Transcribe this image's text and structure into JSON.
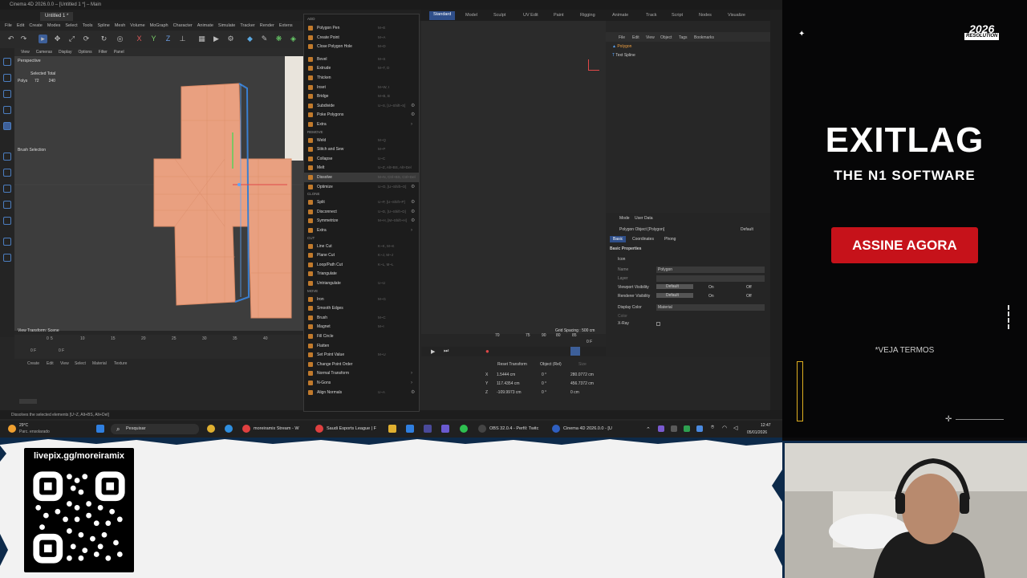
{
  "window": {
    "title": "Cinema 4D 2026.0.0 – [Untitled 1 *] – Main",
    "doc_tab": "Untitled 1 *"
  },
  "menubar": [
    "File",
    "Edit",
    "Create",
    "Modes",
    "Select",
    "Tools",
    "Spline",
    "Mesh",
    "Volume",
    "MoGraph",
    "Character",
    "Animate",
    "Simulate",
    "Tracker",
    "Render",
    "Extens"
  ],
  "layout_tabs": [
    "Standard",
    "Model",
    "Sculpt",
    "UV Edit",
    "Paint",
    "Rigging",
    "Animate",
    "Track",
    "Script",
    "Nodes",
    "Visualize"
  ],
  "viewport": {
    "menu": [
      "View",
      "Cameras",
      "Display",
      "Options",
      "Filter",
      "Panel"
    ],
    "title": "Perspective",
    "stats_header": "Selected Total",
    "stats_label": "Polys",
    "stats_selected": "72",
    "stats_total": "240",
    "brush_label": "Brush Selection",
    "transform_label": "View Transform: Scene",
    "grid_spacing": "Grid Spacing : 500 cm"
  },
  "timeline": {
    "ticks": [
      "0",
      "5",
      "10",
      "15",
      "20",
      "25",
      "30",
      "35",
      "40"
    ],
    "frame_start": "0 F",
    "frame_current": "0 F",
    "right_ticks": [
      "70",
      "75",
      "80",
      "85",
      "90"
    ],
    "right_frame": "0 F"
  },
  "material": {
    "menu": [
      "Create",
      "Edit",
      "View",
      "Select",
      "Material",
      "Texture"
    ]
  },
  "menu": {
    "add_section": "ADD",
    "items": [
      {
        "label": "Polygon Pen",
        "shortcut": "M~E",
        "section": "",
        "gear": false,
        "arrow": false
      },
      {
        "label": "Create Point",
        "shortcut": "M~A",
        "section": "",
        "gear": false,
        "arrow": false
      },
      {
        "label": "Close Polygon Hole",
        "shortcut": "M~D",
        "section": "",
        "gear": false,
        "arrow": false
      },
      {
        "label": "Bevel",
        "shortcut": "M~S",
        "section": "",
        "gear": false,
        "arrow": false
      },
      {
        "label": "Extrude",
        "shortcut": "M~T, D",
        "section": "",
        "gear": false,
        "arrow": false
      },
      {
        "label": "Thicken",
        "shortcut": "",
        "section": "",
        "gear": false,
        "arrow": false
      },
      {
        "label": "Inset",
        "shortcut": "M~W, I",
        "section": "",
        "gear": false,
        "arrow": false
      },
      {
        "label": "Bridge",
        "shortcut": "M~B, B",
        "section": "",
        "gear": false,
        "arrow": false
      },
      {
        "label": "Subdivide",
        "shortcut": "U~S, [U~Shift~S]",
        "section": "",
        "gear": true,
        "arrow": false
      },
      {
        "label": "Poke Polygons",
        "shortcut": "",
        "section": "",
        "gear": true,
        "arrow": false
      },
      {
        "label": "Extra",
        "shortcut": "",
        "section": "",
        "gear": false,
        "arrow": true
      },
      {
        "label": "Weld",
        "shortcut": "M~Q",
        "section": "REMOVE",
        "gear": false,
        "arrow": false
      },
      {
        "label": "Stitch and Sew",
        "shortcut": "M~P",
        "section": "",
        "gear": false,
        "arrow": false
      },
      {
        "label": "Collapse",
        "shortcut": "U~C",
        "section": "",
        "gear": false,
        "arrow": false
      },
      {
        "label": "Melt",
        "shortcut": "U~Z, Alt+BS, Alt+Del",
        "section": "",
        "gear": false,
        "arrow": false
      },
      {
        "label": "Dissolve",
        "shortcut": "M~N, Ctrl+BS, Ctrl+Del",
        "section": "",
        "gear": false,
        "arrow": false
      },
      {
        "label": "Optimize",
        "shortcut": "U~O, [U~Shift~O]",
        "section": "",
        "gear": true,
        "arrow": false
      },
      {
        "label": "Split",
        "shortcut": "U~P, [U~Shift~P]",
        "section": "CLONE",
        "gear": true,
        "arrow": false
      },
      {
        "label": "Disconnect",
        "shortcut": "U~D, [U~Shift~D]",
        "section": "",
        "gear": true,
        "arrow": false
      },
      {
        "label": "Symmetrize",
        "shortcut": "M~H, [M~Shift~H]",
        "section": "",
        "gear": true,
        "arrow": false
      },
      {
        "label": "Extra",
        "shortcut": "",
        "section": "",
        "gear": false,
        "arrow": true
      },
      {
        "label": "Line Cut",
        "shortcut": "K~K, M~K",
        "section": "CUT",
        "gear": false,
        "arrow": false
      },
      {
        "label": "Plane Cut",
        "shortcut": "K~J, M~J",
        "section": "",
        "gear": false,
        "arrow": false
      },
      {
        "label": "Loop/Path Cut",
        "shortcut": "K~L, M~L",
        "section": "",
        "gear": false,
        "arrow": false
      },
      {
        "label": "Triangulate",
        "shortcut": "",
        "section": "",
        "gear": false,
        "arrow": false
      },
      {
        "label": "Untriangulate",
        "shortcut": "U~U",
        "section": "",
        "gear": false,
        "arrow": false
      },
      {
        "label": "Iron",
        "shortcut": "M~G",
        "section": "MOVE",
        "gear": false,
        "arrow": false
      },
      {
        "label": "Smooth Edges",
        "shortcut": "",
        "section": "",
        "gear": false,
        "arrow": false
      },
      {
        "label": "Brush",
        "shortcut": "M~C",
        "section": "",
        "gear": false,
        "arrow": false
      },
      {
        "label": "Magnet",
        "shortcut": "M~I",
        "section": "",
        "gear": false,
        "arrow": false
      },
      {
        "label": "Fill Circle",
        "shortcut": "",
        "section": "",
        "gear": false,
        "arrow": false
      },
      {
        "label": "Flatten",
        "shortcut": "",
        "section": "",
        "gear": false,
        "arrow": false
      },
      {
        "label": "Set Point Value",
        "shortcut": "M~U",
        "section": "",
        "gear": false,
        "arrow": false
      },
      {
        "label": "Change Point Order",
        "shortcut": "",
        "section": "",
        "gear": false,
        "arrow": false
      },
      {
        "label": "Normal Transform",
        "shortcut": "",
        "section": "",
        "gear": false,
        "arrow": true
      },
      {
        "label": "N-Gons",
        "shortcut": "",
        "section": "",
        "gear": false,
        "arrow": true
      },
      {
        "label": "Align Normals",
        "shortcut": "U~A",
        "section": "",
        "gear": true,
        "arrow": false
      }
    ]
  },
  "objects": {
    "menu": [
      "File",
      "Edit",
      "View",
      "Object",
      "Tags",
      "Bookmarks"
    ],
    "items": [
      "Polygon",
      "Text Spline"
    ]
  },
  "attributes": {
    "menu": [
      "Mode",
      "User Data"
    ],
    "object_title": "Polygon Object [Polygon]",
    "preset": "Default",
    "tabs": [
      "Basic",
      "Coordinates",
      "Phong"
    ],
    "section": "Basic Properties",
    "icon_label": "Icon",
    "fields": [
      {
        "label": "Name",
        "value": "Polygon"
      },
      {
        "label": "Layer",
        "value": ""
      },
      {
        "label": "Viewport Visibility",
        "value": "Default",
        "on": "On",
        "off": "Off"
      },
      {
        "label": "Renderer Visibility",
        "value": "Default",
        "on": "On",
        "off": "Off"
      },
      {
        "label": "Display Color",
        "value": "Material"
      },
      {
        "label": "Color",
        "value": ""
      },
      {
        "label": "X-Ray",
        "value": ""
      }
    ]
  },
  "coords": {
    "reset": "Reset Transform",
    "mode": "Object (Rel)",
    "size_label": "Size",
    "rows": [
      {
        "axis": "X",
        "pos": "1.5444 cm",
        "rot": "0 °",
        "size": "280.0772 cm"
      },
      {
        "axis": "Y",
        "pos": "117.4354 cm",
        "rot": "0 °",
        "size": "456.7372 cm"
      },
      {
        "axis": "Z",
        "pos": "-109.9973 cm",
        "rot": "0 °",
        "size": "0 cm"
      }
    ]
  },
  "status": "Dissolves the selected elements [U~Z, Alt+BS, Alt+Del]",
  "taskbar": {
    "weather_temp": "29°C",
    "weather_desc": "Parc. ensolarado",
    "search": "Pesquisar",
    "apps": [
      "moreiramix Stream - W",
      "Saudi Esports League | F",
      "OBS 32.0.4 - Perfil: Twitc",
      "Cinema 4D 2026.0.0 - [U"
    ],
    "time": "12:47",
    "date": "05/01/2026"
  },
  "banner": {
    "logo_line1": "2026",
    "logo_line2": "RESOLUTION",
    "brand": "EXITLAG",
    "tagline": "THE N1 SOFTWARE",
    "cta": "ASSINE AGORA",
    "terms": "*VEJA TERMOS"
  },
  "overlay": {
    "qr_url": "livepix.gg/moreiramix"
  },
  "colors": {
    "menu_icon": "#c17a2c",
    "accent_blue": "#2f4f8a",
    "banner_red": "#c6121a",
    "mesh": "#e9a080"
  }
}
